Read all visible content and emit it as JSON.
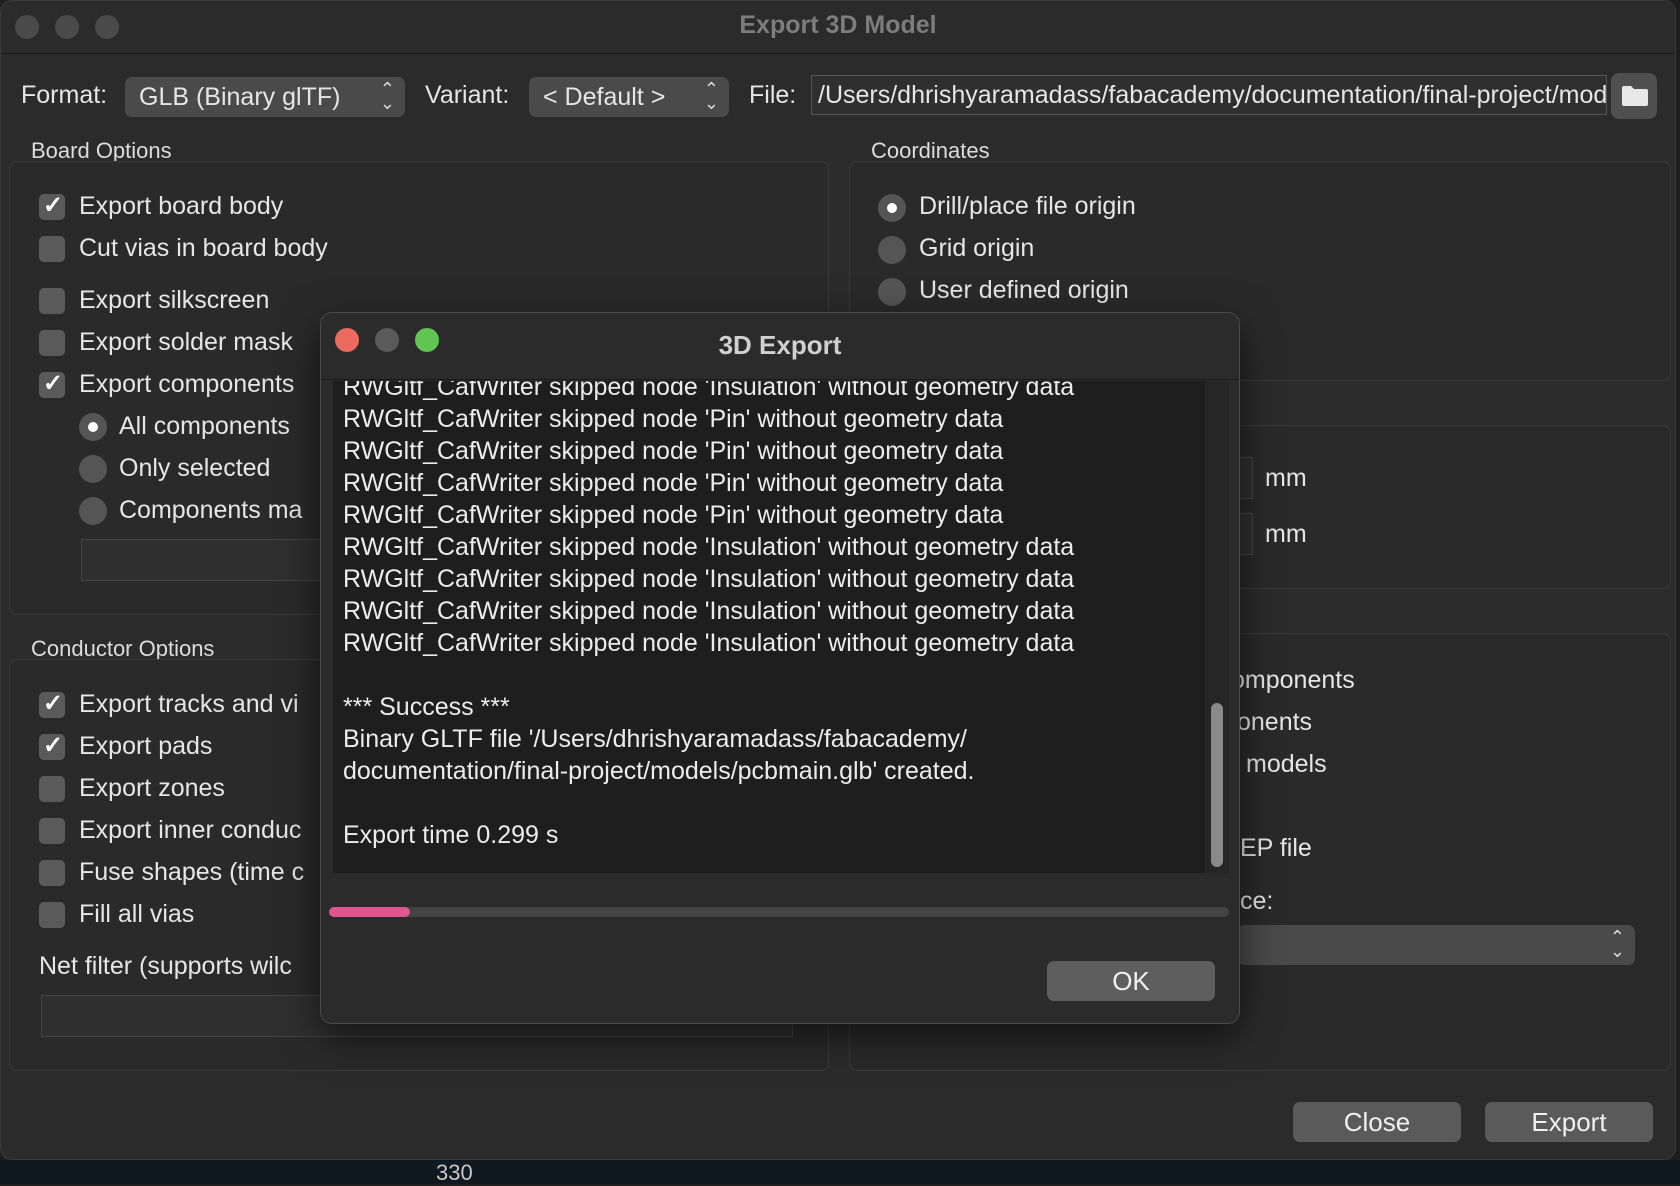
{
  "window": {
    "title": "Export 3D Model",
    "format_label": "Format:",
    "format_value": "GLB (Binary glTF)",
    "variant_label": "Variant:",
    "variant_value": "< Default >",
    "file_label": "File:",
    "file_value": "/Users/dhrishyaramadass/fabacademy/documentation/final-project/models/pcbmain.glb"
  },
  "board_options": {
    "title": "Board Options",
    "items": [
      {
        "label": "Export board body",
        "checked": true
      },
      {
        "label": "Cut vias in board body",
        "checked": false
      },
      {
        "label": "Export silkscreen",
        "checked": false
      },
      {
        "label": "Export solder mask",
        "checked": false
      },
      {
        "label": "Export components",
        "checked": true
      }
    ],
    "component_modes": [
      {
        "label": "All components",
        "selected": true
      },
      {
        "label": "Only selected",
        "selected": false
      },
      {
        "label": "Components ma",
        "selected": false
      }
    ]
  },
  "coordinates": {
    "title": "Coordinates",
    "items": [
      {
        "label": "Drill/place file origin",
        "selected": true
      },
      {
        "label": "Grid origin",
        "selected": false
      },
      {
        "label": "User defined origin",
        "selected": false
      }
    ],
    "unit_1": "mm",
    "unit_2": "mm"
  },
  "conductor_options": {
    "title": "Conductor Options",
    "items": [
      {
        "label": "Export tracks and vi",
        "checked": true
      },
      {
        "label": "Export pads",
        "checked": true
      },
      {
        "label": "Export zones",
        "checked": false
      },
      {
        "label": "Export inner conduc",
        "checked": false
      },
      {
        "label": "Fuse shapes (time c",
        "checked": false
      },
      {
        "label": "Fill all vias",
        "checked": false
      }
    ],
    "net_filter_label": "Net filter (supports wilc"
  },
  "other_options": {
    "item_1": "omponents",
    "item_2": "onents",
    "item_3": "models",
    "item_4": "EP file",
    "item_5": "ce:"
  },
  "footer": {
    "close_label": "Close",
    "export_label": "Export"
  },
  "dialog": {
    "title": "3D Export",
    "log_lines": [
      "RWGltf_CafWriter skipped node 'Insulation' without geometry data",
      "RWGltf_CafWriter skipped node 'Pin' without geometry data",
      "RWGltf_CafWriter skipped node 'Pin' without geometry data",
      "RWGltf_CafWriter skipped node 'Pin' without geometry data",
      "RWGltf_CafWriter skipped node 'Pin' without geometry data",
      "RWGltf_CafWriter skipped node 'Insulation' without geometry data",
      "RWGltf_CafWriter skipped node 'Insulation' without geometry data",
      "RWGltf_CafWriter skipped node 'Insulation' without geometry data",
      "RWGltf_CafWriter skipped node 'Insulation' without geometry data",
      "",
      "*** Success ***",
      "Binary GLTF file '/Users/dhrishyaramadass/fabacademy/",
      "documentation/final-project/models/pcbmain.glb' created.",
      "",
      "Export time 0.299 s"
    ],
    "progress_percent": 9,
    "ok_label": "OK"
  },
  "background_pcb": {
    "label": "330"
  },
  "colors": {
    "close_red": "#ed6a5e",
    "minimize_gray": "#5a5a5a",
    "zoom_green": "#61c554",
    "progress_pink": "#e0558d"
  }
}
